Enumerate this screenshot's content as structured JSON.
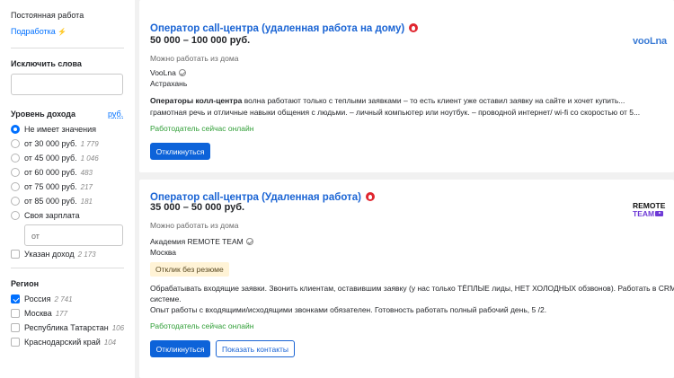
{
  "sidebar": {
    "employment_label": "Постоянная работа",
    "parttime_label": "Подработка",
    "parttime_icon": "lightning-icon",
    "exclude_heading": "Исключить слова",
    "exclude_value": "",
    "income_heading": "Уровень дохода",
    "currency_link": "руб.",
    "income_options": [
      {
        "label": "Не имеет значения",
        "count": "",
        "checked": true
      },
      {
        "label": "от 30 000 руб.",
        "count": "1 779",
        "checked": false
      },
      {
        "label": "от 45 000 руб.",
        "count": "1 046",
        "checked": false
      },
      {
        "label": "от 60 000 руб.",
        "count": "483",
        "checked": false
      },
      {
        "label": "от 75 000 руб.",
        "count": "217",
        "checked": false
      },
      {
        "label": "от 85 000 руб.",
        "count": "181",
        "checked": false
      },
      {
        "label": "Своя зарплата",
        "count": "",
        "checked": false
      }
    ],
    "from_placeholder": "от",
    "income_specified_label": "Указан доход",
    "income_specified_count": "2 173",
    "region_heading": "Регион",
    "regions": [
      {
        "label": "Россия",
        "count": "2 741",
        "checked": true
      },
      {
        "label": "Москва",
        "count": "177",
        "checked": false
      },
      {
        "label": "Республика Татарстан",
        "count": "106",
        "checked": false
      },
      {
        "label": "Краснодарский край",
        "count": "104",
        "checked": false
      }
    ]
  },
  "vacancies": [
    {
      "title": "Оператор call-центра (удаленная работа на дому)",
      "salary": "50 000 – 100 000 руб.",
      "remote": "Можно работать из дома",
      "company": "VooLna",
      "city": "Астрахань",
      "desc_bold": "Операторы колл-центра",
      "desc_line1": " волна работают только с теплыми заявками – то есть клиент уже оставил заявку на сайте и хочет купить...",
      "desc_line2": "грамотная речь и отличные навыки общения с людьми. – личный компьютер или ноутбук. – проводной интернет/ wi-fi со скоростью от 5...",
      "online": "Работодатель сейчас онлайн",
      "respond_label": "Откликнуться",
      "logo_text": "vooLna"
    },
    {
      "title": "Оператор call-центра (Удаленная работа)",
      "salary": "35 000 – 50 000 руб.",
      "remote": "Можно работать из дома",
      "company": "Академия REMOTE TEAM",
      "city": "Москва",
      "tag": "Отклик без резюме",
      "desc_line1": "Обрабатывать входящие заявки. Звонить клиентам, оставившим заявку (у нас только ТЁПЛЫЕ лиды, НЕТ ХОЛОДНЫХ обзвонов). Работать в CRM",
      "desc_line2": "системе.",
      "desc_line3": "Опыт работы с входящими/исходящими звонками обязателен. Готовность работать полный рабочий день, 5 /2.",
      "online": "Работодатель сейчас онлайн",
      "respond_label": "Откликнуться",
      "contacts_label": "Показать контакты",
      "logo_top": "REMOTE",
      "logo_bottom": "TEAM"
    }
  ],
  "colors": {
    "accent": "#0070ff",
    "title_link": "#1a64d4",
    "online_green": "#2f9e36",
    "hot_badge": "#e0262f"
  },
  "icons": [
    "fire-icon",
    "verified-icon",
    "lightning-icon",
    "play-icon"
  ]
}
